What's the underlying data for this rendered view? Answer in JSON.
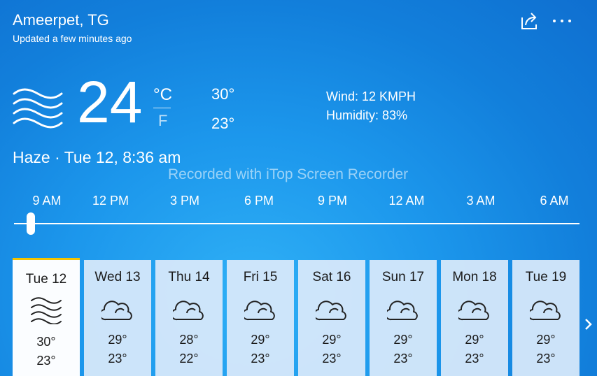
{
  "location": {
    "name": "Ameerpet, TG",
    "updated": "Updated a few minutes ago"
  },
  "toolbar": {
    "share_icon": "share-icon",
    "more_icon": "more-icon"
  },
  "current": {
    "icon": "haze-icon",
    "temp": "24",
    "unit_c": "°C",
    "unit_f": "F",
    "high": "30°",
    "low": "23°",
    "wind": "Wind: 12 KMPH",
    "humidity": "Humidity: 83%",
    "condition": "Haze · Tue 12, 8:36 am"
  },
  "watermark": "Recorded with iTop Screen Recorder",
  "hourly": {
    "labels": [
      "9 AM",
      "12 PM",
      "3 PM",
      "6 PM",
      "9 PM",
      "12 AM",
      "3 AM",
      "6 AM"
    ],
    "slider_position": 0.03
  },
  "daily": [
    {
      "day": "Tue 12",
      "icon": "haze-icon",
      "high": "30°",
      "low": "23°",
      "selected": true
    },
    {
      "day": "Wed 13",
      "icon": "cloudy-icon",
      "high": "29°",
      "low": "23°"
    },
    {
      "day": "Thu 14",
      "icon": "cloudy-icon",
      "high": "28°",
      "low": "22°"
    },
    {
      "day": "Fri 15",
      "icon": "cloudy-icon",
      "high": "29°",
      "low": "23°"
    },
    {
      "day": "Sat 16",
      "icon": "cloudy-icon",
      "high": "29°",
      "low": "23°"
    },
    {
      "day": "Sun 17",
      "icon": "cloudy-icon",
      "high": "29°",
      "low": "23°"
    },
    {
      "day": "Mon 18",
      "icon": "cloudy-icon",
      "high": "29°",
      "low": "23°"
    },
    {
      "day": "Tue 19",
      "icon": "cloudy-icon",
      "high": "29°",
      "low": "23°"
    }
  ],
  "nav": {
    "next_icon": "chevron-right-icon"
  },
  "colors": {
    "accent": "#f4c400",
    "card": "#d6e8fa",
    "card_selected": "#fbfdff"
  }
}
